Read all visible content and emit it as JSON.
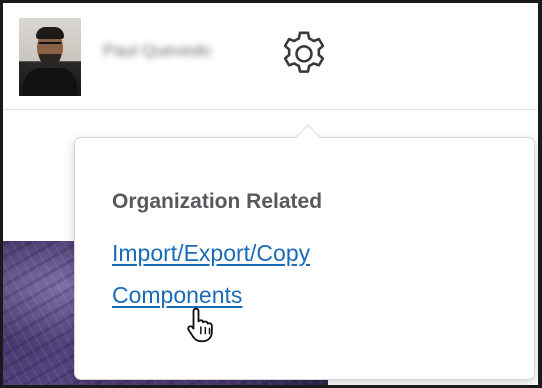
{
  "header": {
    "user_name": "Paul Quevedo",
    "avatar_icon": "avatar",
    "settings_icon": "gear-icon"
  },
  "settings_menu": {
    "heading": "Organization Related",
    "links": [
      {
        "label": "Import/Export/Copy"
      },
      {
        "label": "Components"
      }
    ]
  },
  "colors": {
    "link": "#1a6bb8",
    "heading": "#565a5c",
    "border": "#d6d6d6"
  },
  "cursor_icon": "hand-pointer-icon"
}
